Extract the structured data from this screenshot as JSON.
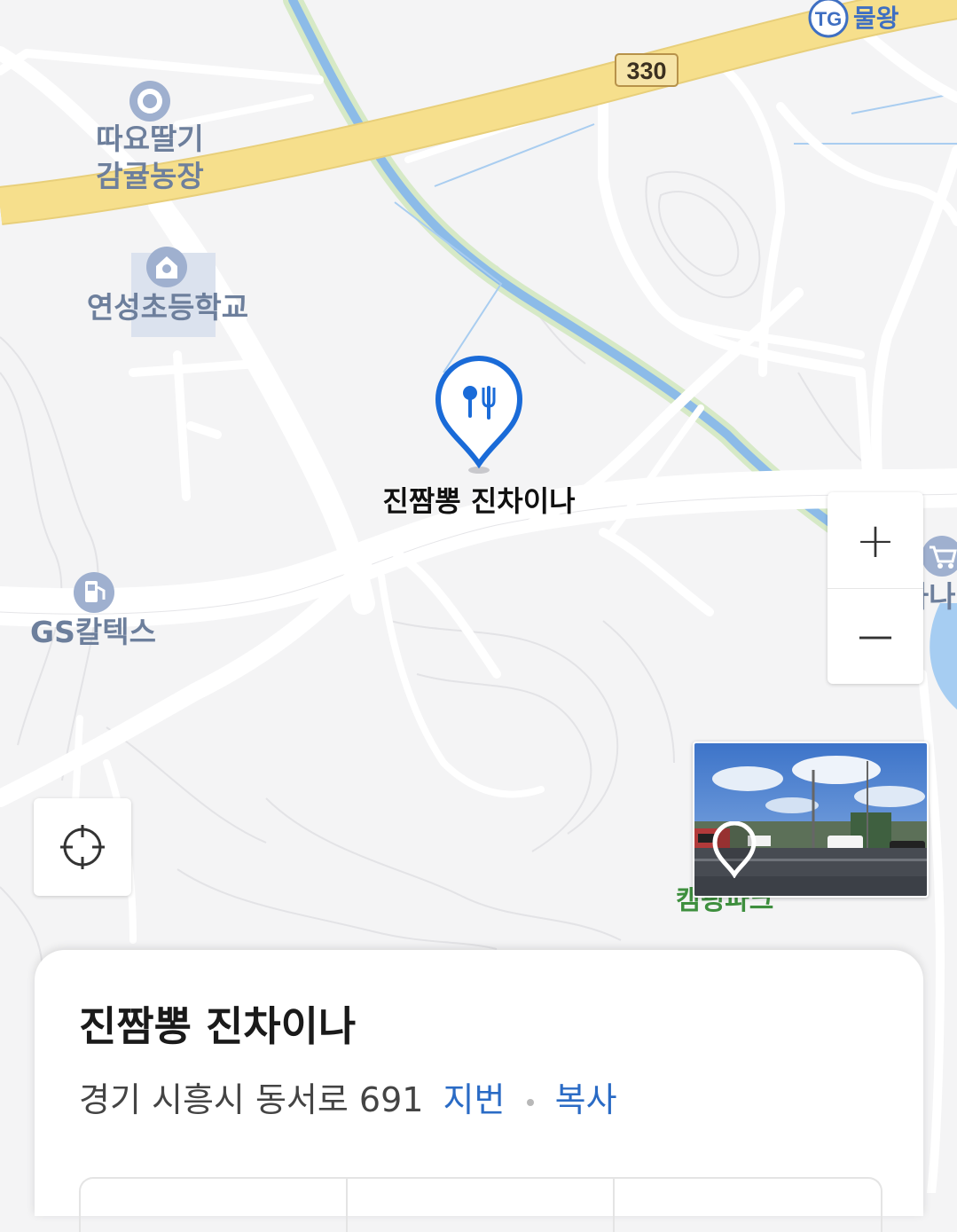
{
  "map": {
    "highway_badge": "330",
    "tg_badge": "TG",
    "tg_label": "물왕",
    "poi_farm_line1": "따요딸기",
    "poi_farm_line2": "감귤농장",
    "poi_school": "연성초등학교",
    "poi_gas": "GS칼텍스",
    "poi_camping": "캠핑파크",
    "poi_mart_partial": "농협하나",
    "selected_place_label": "진짬뽕 진차이나",
    "colors": {
      "highway": "#f6df8c",
      "water": "#8cbbe8",
      "marker": "#1a6bd8",
      "link": "#2a6bc5"
    }
  },
  "controls": {
    "zoom_in": "+",
    "zoom_out": "—",
    "locate_icon": "crosshair-icon"
  },
  "sheet": {
    "title": "진짬뽕 진차이나",
    "address": "경기 시흥시 동서로 691",
    "lot_number_link": "지번",
    "copy_link": "복사"
  }
}
